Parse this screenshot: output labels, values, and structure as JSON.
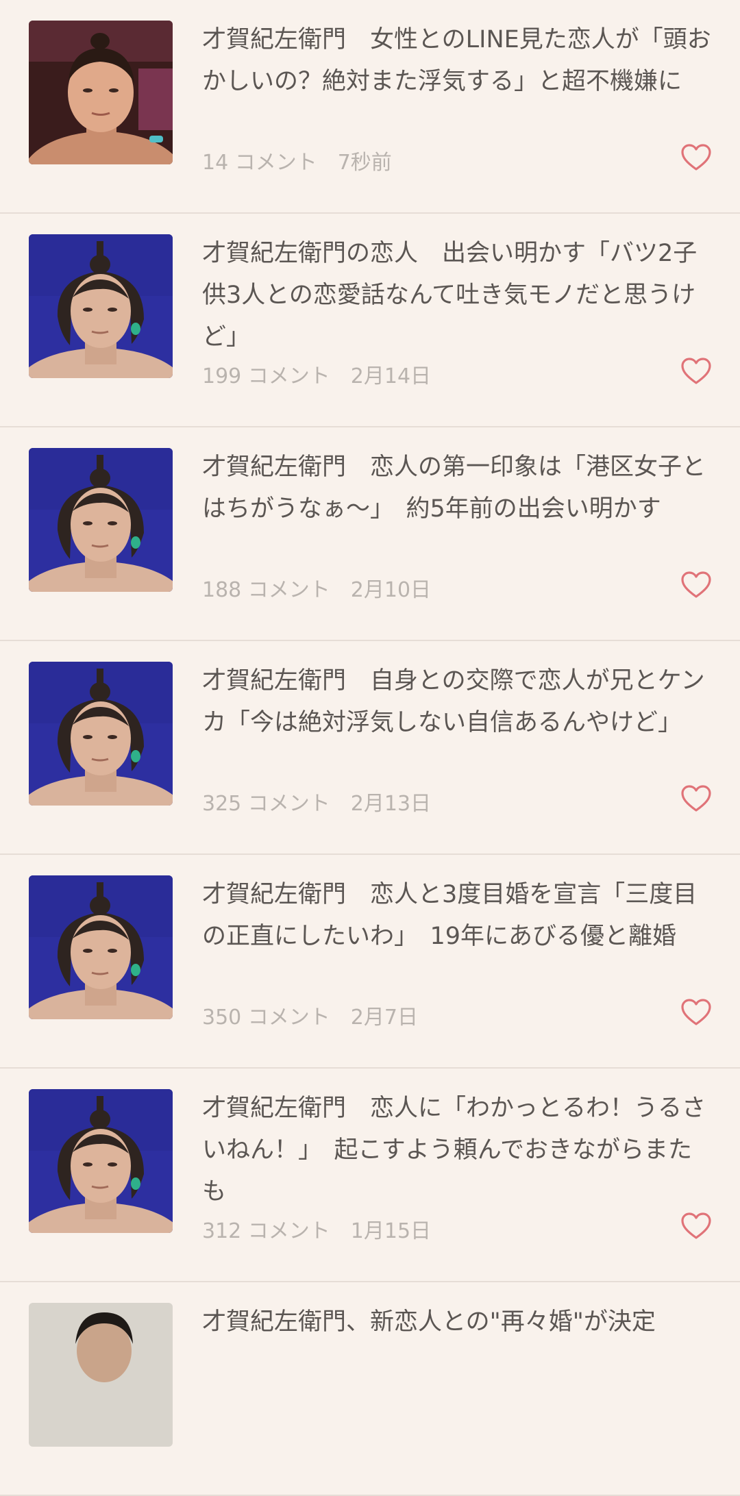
{
  "colors": {
    "background": "#f9f2ec",
    "title_text": "#5b5653",
    "meta_text": "#b9b3ae",
    "heart": "#e07378"
  },
  "icons": {
    "favorite": "heart-outline-icon"
  },
  "articles": [
    {
      "title": "才賀紀左衛門　女性とのLINE見た恋人が「頭おかしいの？絶対また浮気する」と超不機嫌に",
      "comments": "14 コメント",
      "time": "7秒前",
      "thumb": "fighter-ring"
    },
    {
      "title": "才賀紀左衛門の恋人　出会い明かす「バツ2子供3人との恋愛話なんて吐き気モノだと思うけど」",
      "comments": "199 コメント",
      "time": "2月14日",
      "thumb": "fighter-blue"
    },
    {
      "title": "才賀紀左衛門　恋人の第一印象は「港区女子とはちがうなぁ～」　約5年前の出会い明かす",
      "comments": "188 コメント",
      "time": "2月10日",
      "thumb": "fighter-blue"
    },
    {
      "title": "才賀紀左衛門　自身との交際で恋人が兄とケンカ「今は絶対浮気しない自信あるんやけど」",
      "comments": "325 コメント",
      "time": "2月13日",
      "thumb": "fighter-blue"
    },
    {
      "title": "才賀紀左衛門　恋人と3度目婚を宣言「三度目の正直にしたいわ」　19年にあびる優と離婚",
      "comments": "350 コメント",
      "time": "2月7日",
      "thumb": "fighter-blue"
    },
    {
      "title": "才賀紀左衛門　恋人に「わかっとるわ！うるさいねん！」　起こすよう頼んでおきながらまたも",
      "comments": "312 コメント",
      "time": "1月15日",
      "thumb": "fighter-blue"
    },
    {
      "title": "才賀紀左衛門、新恋人との\"再々婚\"が決定",
      "comments": "",
      "time": "",
      "thumb": "portrait-light"
    }
  ]
}
